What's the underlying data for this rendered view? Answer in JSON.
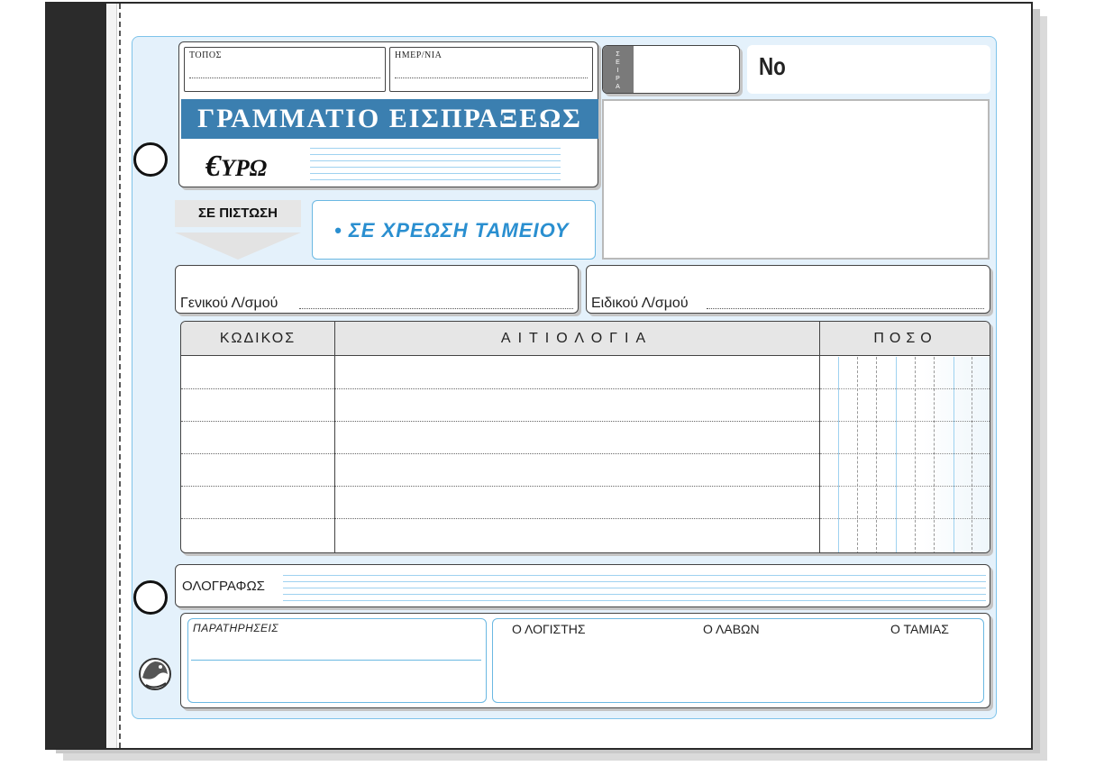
{
  "header": {
    "place_label": "ΤΟΠΟΣ",
    "date_label": "ΗΜΕΡ/ΝΙΑ",
    "title": "ΓΡΑΜΜΑΤΙΟ ΕΙΣΠΡΑΞΕΩΣ",
    "currency_symbol": "€",
    "currency_text": "ΥΡΩ",
    "series_label": "ΣΕΙΡΑ",
    "number_label": "Νο"
  },
  "entry": {
    "credit_label": "ΣΕ ΠΙΣΤΩΣΗ",
    "debit_label": "• ΣΕ ΧΡΕΩΣΗ ΤΑΜΕΙΟΥ"
  },
  "accounts": {
    "general_label": "Γενικού Λ/σμού",
    "special_label": "Ειδικού Λ/σμού"
  },
  "table": {
    "columns": [
      "ΚΩΔΙΚΟΣ",
      "ΑΙΤΙΟΛΟΓΙΑ",
      "ΠΟΣΟ"
    ]
  },
  "words": {
    "label": "ΟΛΟΓΡΑΦΩΣ"
  },
  "footer": {
    "notes_label": "ΠΑΡΑΤΗΡΗΣΕΙΣ",
    "signatures": [
      "Ο ΛΟΓΙΣΤΗΣ",
      "Ο ΛΑΒΩΝ",
      "Ο ΤΑΜΙΑΣ"
    ]
  },
  "colors": {
    "title_band": "#3b7fb0",
    "accent_blue": "#2a8fd0",
    "form_background": "#e4f1fb"
  },
  "icons": {
    "logo": "publisher-logo-icon"
  }
}
